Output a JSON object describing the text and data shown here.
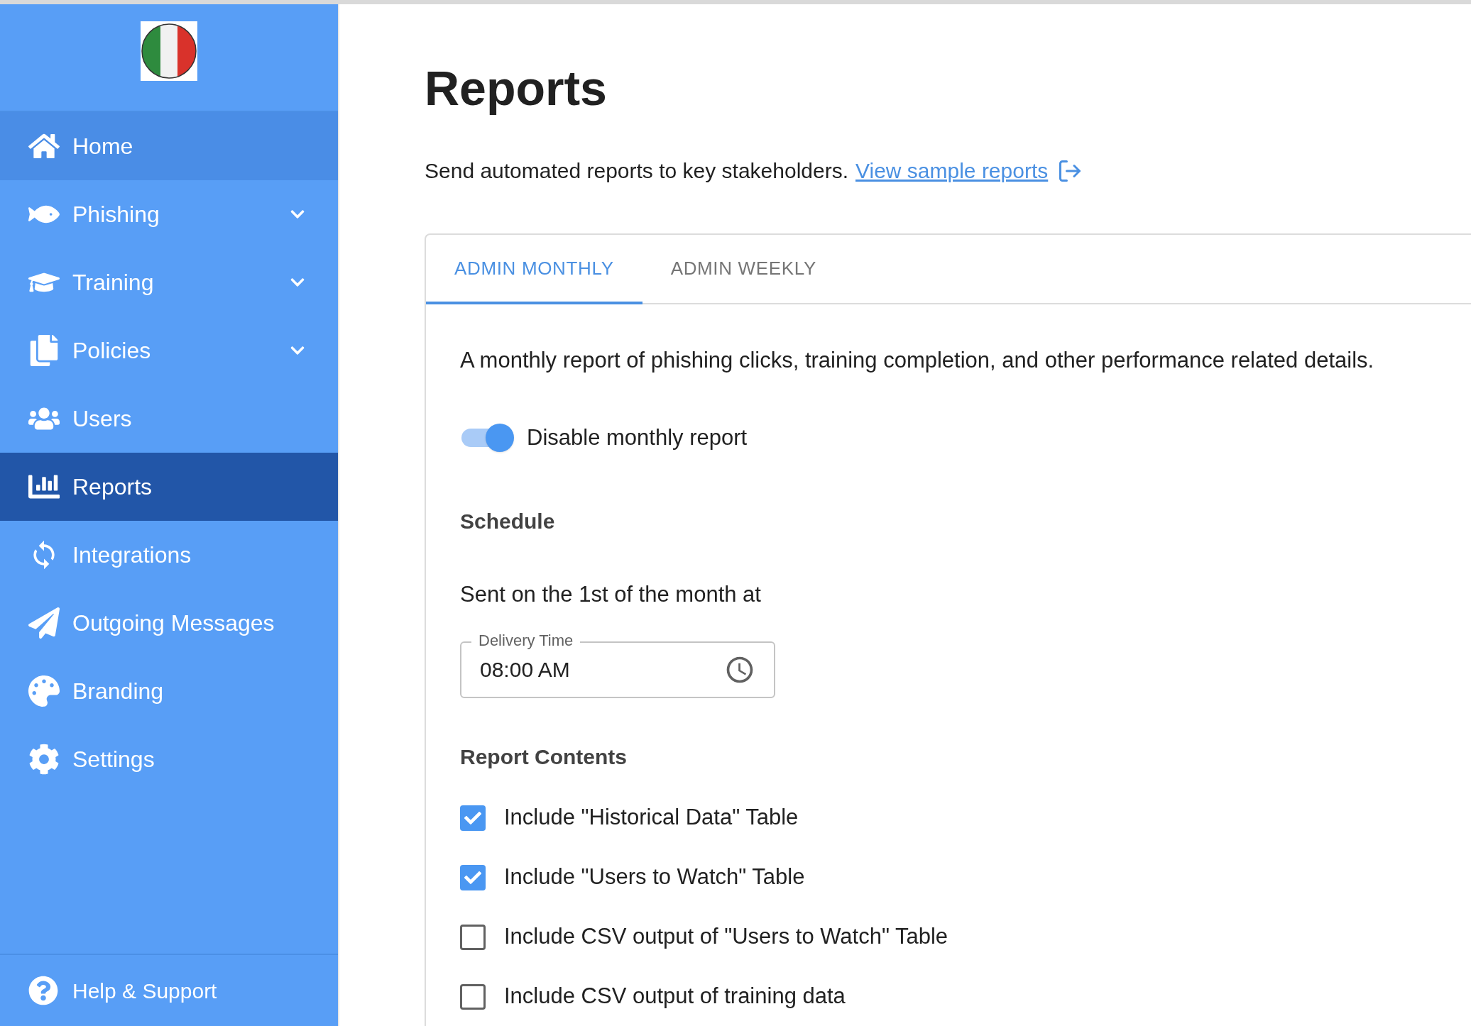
{
  "sidebar": {
    "items": [
      {
        "label": "Home",
        "selected": false,
        "hovered": true,
        "expandable": false
      },
      {
        "label": "Phishing",
        "selected": false,
        "hovered": false,
        "expandable": true
      },
      {
        "label": "Training",
        "selected": false,
        "hovered": false,
        "expandable": true
      },
      {
        "label": "Policies",
        "selected": false,
        "hovered": false,
        "expandable": true
      },
      {
        "label": "Users",
        "selected": false,
        "hovered": false,
        "expandable": false
      },
      {
        "label": "Reports",
        "selected": true,
        "hovered": false,
        "expandable": false
      },
      {
        "label": "Integrations",
        "selected": false,
        "hovered": false,
        "expandable": false
      },
      {
        "label": "Outgoing Messages",
        "selected": false,
        "hovered": false,
        "expandable": false
      },
      {
        "label": "Branding",
        "selected": false,
        "hovered": false,
        "expandable": false
      },
      {
        "label": "Settings",
        "selected": false,
        "hovered": false,
        "expandable": false
      }
    ],
    "footer": {
      "label": "Help & Support"
    }
  },
  "page": {
    "title": "Reports",
    "subtitle": "Send automated reports to key stakeholders.",
    "link": "View sample reports"
  },
  "tabs": [
    {
      "label": "ADMIN MONTHLY",
      "selected": true
    },
    {
      "label": "ADMIN WEEKLY",
      "selected": false
    }
  ],
  "panel": {
    "description": "A monthly report of phishing clicks, training completion, and other performance related details.",
    "toggle": {
      "label": "Disable monthly report",
      "on": true
    },
    "schedule_heading": "Schedule",
    "schedule_text": "Sent on the 1st of the month at",
    "delivery_time": {
      "label": "Delivery Time",
      "value": "08:00 AM"
    },
    "contents_heading": "Report Contents",
    "options": [
      {
        "label": "Include \"Historical Data\" Table",
        "checked": true
      },
      {
        "label": "Include \"Users to Watch\" Table",
        "checked": true
      },
      {
        "label": "Include CSV output of \"Users to Watch\" Table",
        "checked": false
      },
      {
        "label": "Include CSV output of training data",
        "checked": false
      }
    ]
  }
}
